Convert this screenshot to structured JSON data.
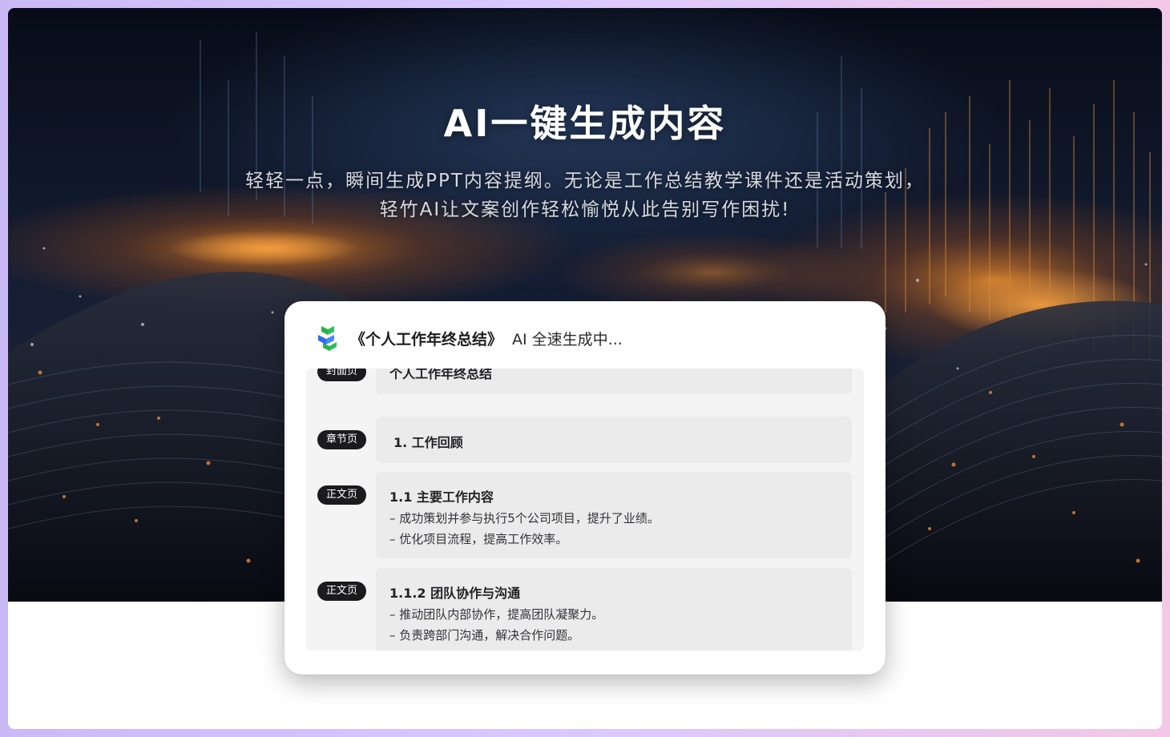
{
  "hero": {
    "title": "AI一键生成内容",
    "subtitle_line1": "轻轻一点，瞬间生成PPT内容提纲。无论是工作总结教学课件还是活动策划，",
    "subtitle_line2": "轻竹AI让文案创作轻松愉悦从此告别写作困扰!"
  },
  "card": {
    "logo_icon": "bamboo-logo-icon",
    "doc_title": "《个人工作年终总结》",
    "status": "AI 全速生成中...",
    "outline": [
      {
        "tag": "封面页",
        "title": "个人工作年终总结",
        "lines": []
      },
      {
        "tag": "章节页",
        "title": "1. 工作回顾",
        "lines": []
      },
      {
        "tag": "正文页",
        "title": "1.1 主要工作内容",
        "lines": [
          "– 成功策划并参与执行5个公司项目，提升了业绩。",
          "– 优化项目流程，提高工作效率。"
        ]
      },
      {
        "tag": "正文页",
        "title": "1.1.2 团队协作与沟通",
        "lines": [
          "– 推动团队内部协作，提高团队凝聚力。",
          "– 负责跨部门沟通，解决合作问题。"
        ]
      }
    ]
  },
  "colors": {
    "tag_background": "#1b1b1d",
    "logo_green": "#2fb04a",
    "logo_blue": "#2f6bf0"
  }
}
